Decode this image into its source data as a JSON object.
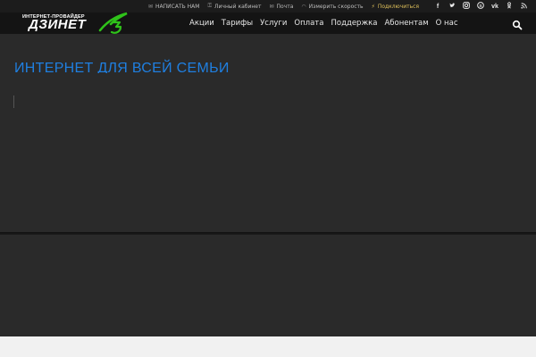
{
  "topbar": {
    "links": [
      {
        "icon": "mail-icon",
        "glyph": "✉",
        "label": "НАПИСАТЬ НАМ"
      },
      {
        "icon": "key-icon",
        "glyph": "⚿",
        "label": "Личный кабинет"
      },
      {
        "icon": "envelope-icon",
        "glyph": "✉",
        "label": "Почта"
      },
      {
        "icon": "wifi-icon",
        "glyph": "◠",
        "label": "Измерить скорость"
      },
      {
        "icon": "plug-icon",
        "glyph": "⚡",
        "label": "Подключиться"
      }
    ],
    "accent_color": "#e0c15a",
    "socials": [
      {
        "icon": "facebook-icon",
        "glyph": "f"
      },
      {
        "icon": "twitter-icon",
        "glyph": "t"
      },
      {
        "icon": "instagram-icon",
        "glyph": "◎"
      },
      {
        "icon": "skype-icon",
        "glyph": "S"
      },
      {
        "icon": "vk-icon",
        "glyph": "vk"
      },
      {
        "icon": "odnoklassniki-icon",
        "glyph": "ok"
      },
      {
        "icon": "rss-icon",
        "glyph": "◥"
      }
    ]
  },
  "logo": {
    "subtitle": "ИНТЕРНЕТ-ПРОВАЙДЕР",
    "name": "ДЗИНЕТ",
    "accent_color": "#2fc21a"
  },
  "nav": {
    "items": [
      "Акции",
      "Тарифы",
      "Услуги",
      "Оплата",
      "Поддержка",
      "Абонентам",
      "О нас"
    ],
    "search_icon": "search-icon"
  },
  "hero": {
    "title": "ИНТЕРНЕТ ДЛЯ ВСЕЙ СЕМЬИ",
    "title_color": "#1f7fe0"
  }
}
